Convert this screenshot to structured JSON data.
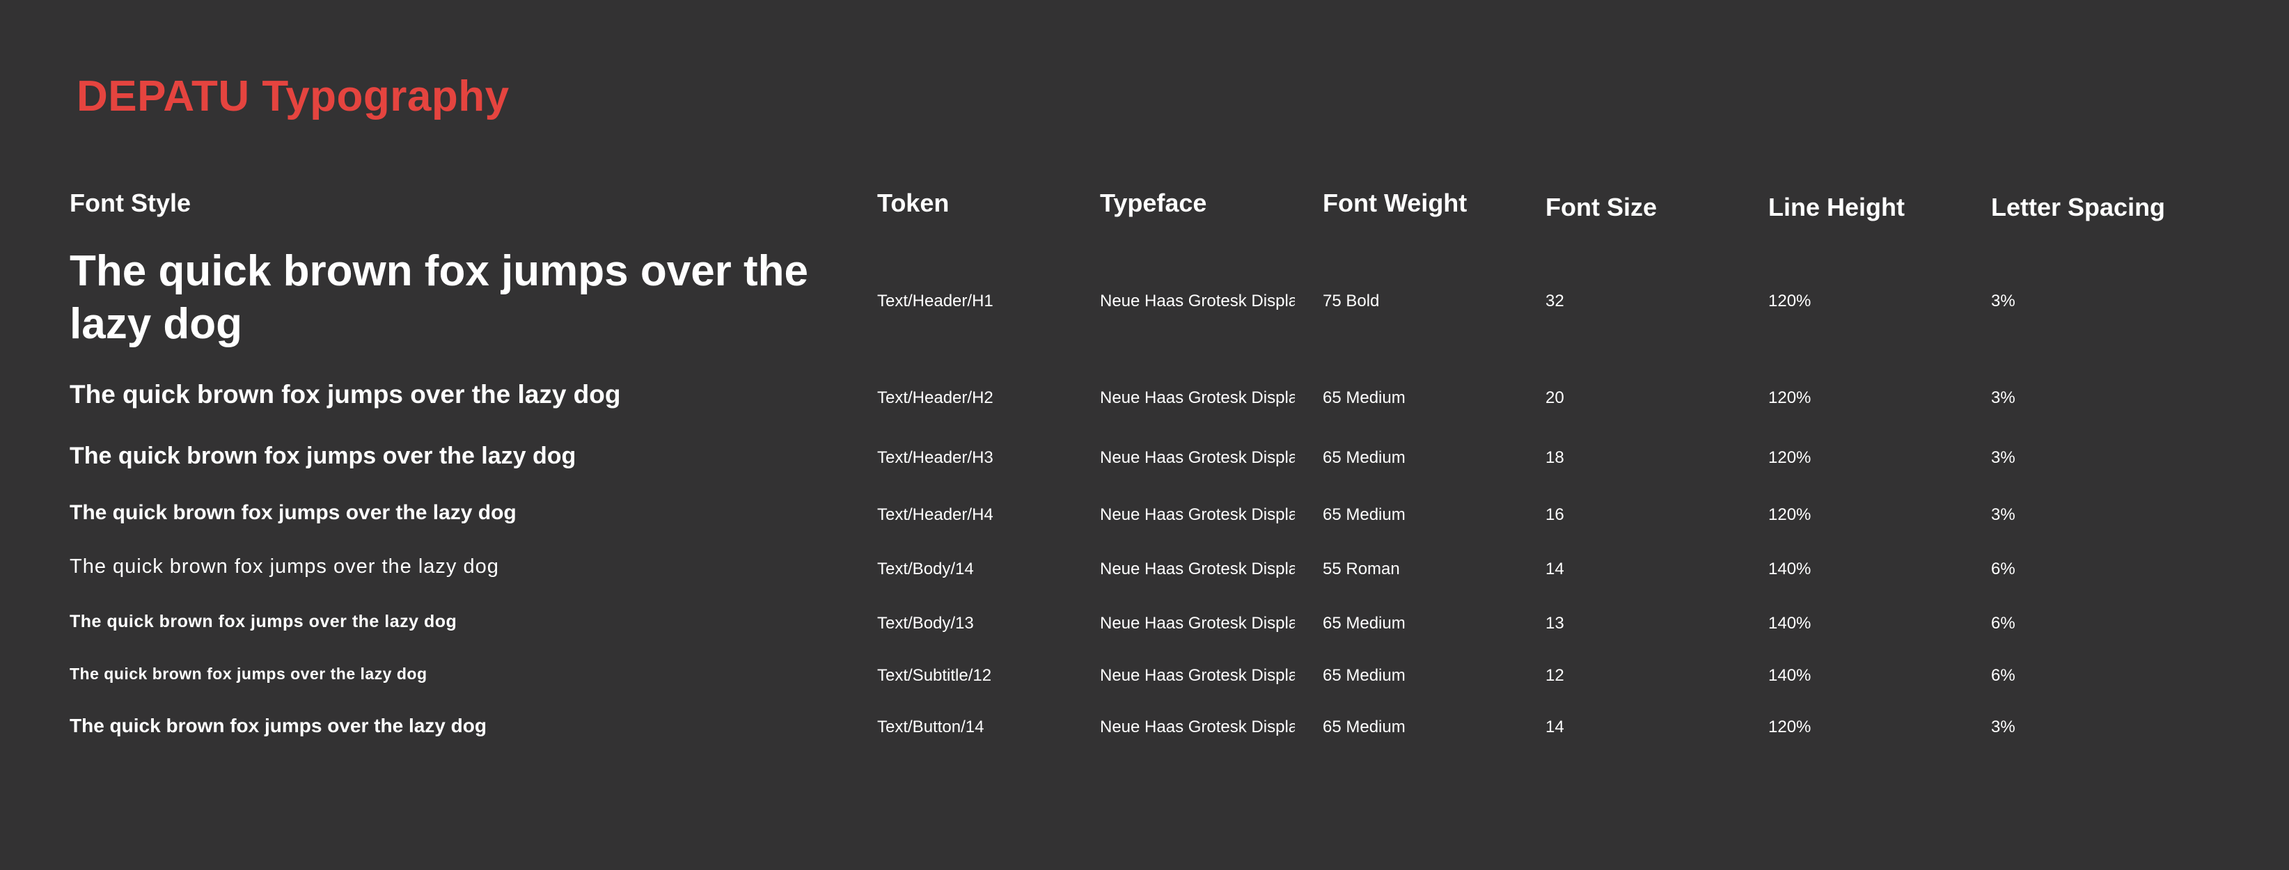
{
  "title": "DEPATU Typography",
  "columns": {
    "font_style": "Font Style",
    "token": "Token",
    "typeface": "Typeface",
    "font_weight": "Font Weight",
    "font_size": "Font Size",
    "line_height": "Line Height",
    "letter_spacing": "Letter Spacing"
  },
  "rows": [
    {
      "sample": "The quick brown fox jumps over the lazy dog",
      "token": "Text/Header/H1",
      "typeface": "Neue Haas Grotesk Display",
      "weight": "75 Bold",
      "size": "32",
      "line_height": "120%",
      "letter_spacing": "3%"
    },
    {
      "sample": "The quick brown fox jumps over the lazy dog",
      "token": "Text/Header/H2",
      "typeface": "Neue Haas Grotesk Display",
      "weight": "65 Medium",
      "size": "20",
      "line_height": "120%",
      "letter_spacing": "3%"
    },
    {
      "sample": "The quick brown fox jumps over the lazy dog",
      "token": "Text/Header/H3",
      "typeface": "Neue Haas Grotesk Display",
      "weight": "65 Medium",
      "size": "18",
      "line_height": "120%",
      "letter_spacing": "3%"
    },
    {
      "sample": "The quick brown fox jumps over the lazy dog",
      "token": "Text/Header/H4",
      "typeface": "Neue Haas Grotesk Display",
      "weight": "65 Medium",
      "size": "16",
      "line_height": "120%",
      "letter_spacing": "3%"
    },
    {
      "sample": "The quick brown fox jumps over the lazy dog",
      "token": "Text/Body/14",
      "typeface": "Neue Haas Grotesk Display",
      "weight": "55 Roman",
      "size": "14",
      "line_height": "140%",
      "letter_spacing": "6%"
    },
    {
      "sample": "The quick brown fox jumps over the lazy dog",
      "token": "Text/Body/13",
      "typeface": "Neue Haas Grotesk Display",
      "weight": "65 Medium",
      "size": "13",
      "line_height": "140%",
      "letter_spacing": "6%"
    },
    {
      "sample": "The quick brown fox jumps over the lazy dog",
      "token": "Text/Subtitle/12",
      "typeface": "Neue Haas Grotesk Display",
      "weight": "65 Medium",
      "size": "12",
      "line_height": "140%",
      "letter_spacing": "6%"
    },
    {
      "sample": "The quick brown fox jumps over the lazy dog",
      "token": "Text/Button/14",
      "typeface": "Neue Haas Grotesk Display",
      "weight": "65 Medium",
      "size": "14",
      "line_height": "120%",
      "letter_spacing": "3%"
    }
  ],
  "colors": {
    "background": "#333233",
    "title": "#e5443f",
    "text": "#ffffff"
  }
}
